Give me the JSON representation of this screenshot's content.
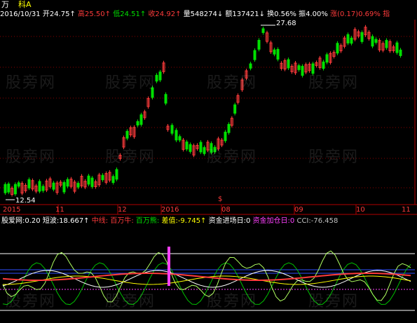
{
  "header": {
    "stock_label": "万",
    "stock_name": "科A",
    "date": "2016/10/31",
    "open": "开24.75↑",
    "high": "高25.50↑",
    "low": "低24.51↑",
    "close": "收24.92↑",
    "volume": "量548274↓",
    "amount": "额137421↓",
    "turnover": "换0.56%",
    "amplitude": "振4.00%",
    "change": "涨(0.17)0.69%",
    "trailing": "指"
  },
  "price_chart": {
    "max_label": "27.68",
    "min_label": "12.54",
    "marker": "$",
    "up_color": "#ff3b3b",
    "down_color": "#00e000"
  },
  "date_axis": [
    "2015",
    "11",
    "12",
    "2016",
    "08",
    "09",
    "10",
    "11"
  ],
  "indicator_bar": {
    "items": [
      {
        "text": "股爱网:0.20",
        "color": "#ffffff"
      },
      {
        "text": "短波:18.667↑",
        "color": "#ffffff"
      },
      {
        "text": "中线:",
        "color": "#ff3b3b"
      },
      {
        "text": "百万牛:",
        "color": "#ff3b3b"
      },
      {
        "text": "百万熊:",
        "color": "#00e000"
      },
      {
        "text": "差值:-9.745↑",
        "color": "#ffff00"
      },
      {
        "text": "资金进场日:0",
        "color": "#ffffff"
      },
      {
        "text": "资金加仓日:0",
        "color": "#ff40ff"
      },
      {
        "text": "CCI:-76.458",
        "color": "#c0c0c0"
      }
    ]
  },
  "watermark": "股旁网"
}
